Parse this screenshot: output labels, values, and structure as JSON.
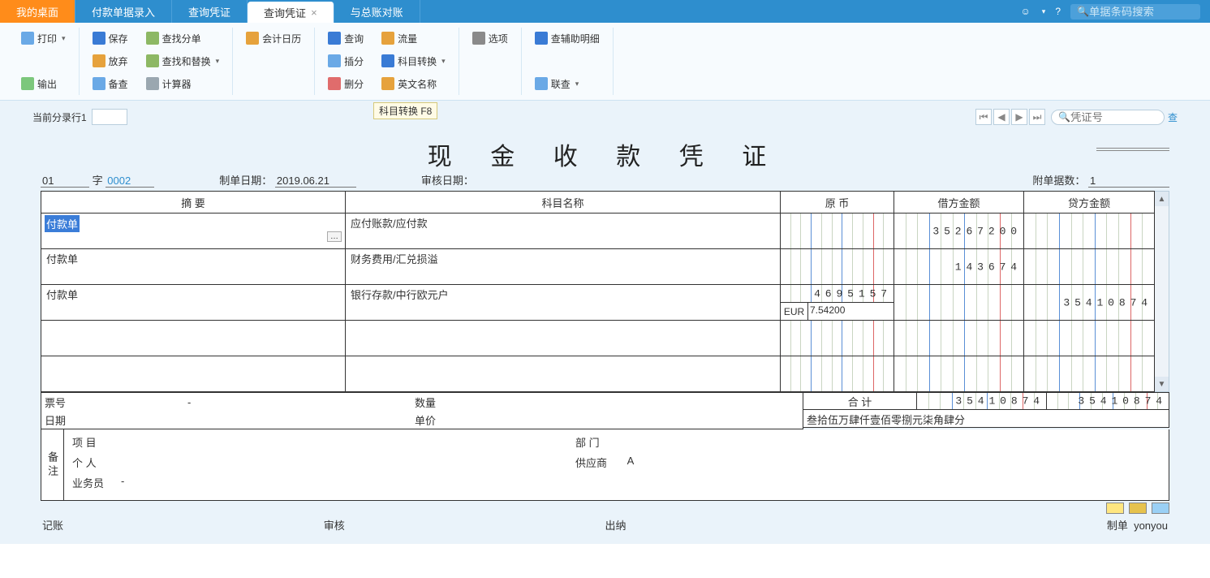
{
  "tabs": {
    "active": "我的桌面",
    "items": [
      "我的桌面",
      "付款单据录入",
      "查询凭证",
      "查询凭证",
      "与总账对账"
    ],
    "selected_index": 3
  },
  "top_search_placeholder": "单据条码搜索",
  "ribbon": {
    "g1": {
      "print": "打印",
      "export": "输出"
    },
    "g2": {
      "save": "保存",
      "discard": "放弃",
      "beicha": "备查",
      "find": "查找分单",
      "findrep": "查找和替换",
      "calc": "计算器"
    },
    "g3": {
      "calendar": "会计日历"
    },
    "g4": {
      "query": "查询",
      "insert": "插分",
      "delete": "删分",
      "flow": "流量",
      "subject": "科目转换",
      "english": "英文名称"
    },
    "g5": {
      "option": "选项"
    },
    "g6": {
      "aux": "查辅助明细",
      "link": "联查"
    }
  },
  "tooltip": "科目转换 F8",
  "subbar": {
    "label": "当前分录行1",
    "voucher_search_placeholder": "凭证号",
    "cha": "查"
  },
  "voucher": {
    "title": "现 金 收 款 凭 证",
    "prefix": "01",
    "zi": "字",
    "number": "0002",
    "date_label": "制单日期：",
    "date": "2019.06.21",
    "audit_label": "审核日期：",
    "audit": "",
    "attach_label": "附单据数：",
    "attach": "1"
  },
  "headers": {
    "summary": "摘 要",
    "subject": "科目名称",
    "orig": "原 币",
    "debit": "借方金额",
    "credit": "贷方金额"
  },
  "rows": [
    {
      "summary": "付款单",
      "subject": "应付账款/应付款",
      "orig": "",
      "cur": "",
      "rate": "",
      "debit": "35267200",
      "credit": ""
    },
    {
      "summary": "付款单",
      "subject": "财务费用/汇兑损溢",
      "orig": "",
      "cur": "",
      "rate": "",
      "debit": "143674",
      "credit": ""
    },
    {
      "summary": "付款单",
      "subject": "银行存款/中行欧元户",
      "orig": "4695157",
      "cur": "EUR",
      "rate": "7.54200",
      "debit": "",
      "credit": "35410874"
    },
    {
      "summary": "",
      "subject": "",
      "orig": "",
      "cur": "",
      "rate": "",
      "debit": "",
      "credit": ""
    },
    {
      "summary": "",
      "subject": "",
      "orig": "",
      "cur": "",
      "rate": "",
      "debit": "",
      "credit": ""
    }
  ],
  "bill_info": {
    "no_label": "票号",
    "no_dash": "-",
    "date_label": "日期",
    "qty_label": "数量",
    "price_label": "单价"
  },
  "totals": {
    "heji": "合 计",
    "debit": "35410874",
    "credit": "35410874",
    "big": "叁拾伍万肆仟壹佰零捌元柒角肆分"
  },
  "remark": {
    "side": "备注",
    "project_label": "项 目",
    "project": "",
    "dept_label": "部 门",
    "dept": "",
    "person_label": "个 人",
    "person": "",
    "supplier_label": "供应商",
    "supplier": "A",
    "staff_label": "业务员",
    "staff": "-"
  },
  "footer": {
    "jz": "记账",
    "sh": "审核",
    "cn": "出纳",
    "zd": "制单",
    "zd_val": "yonyou"
  }
}
